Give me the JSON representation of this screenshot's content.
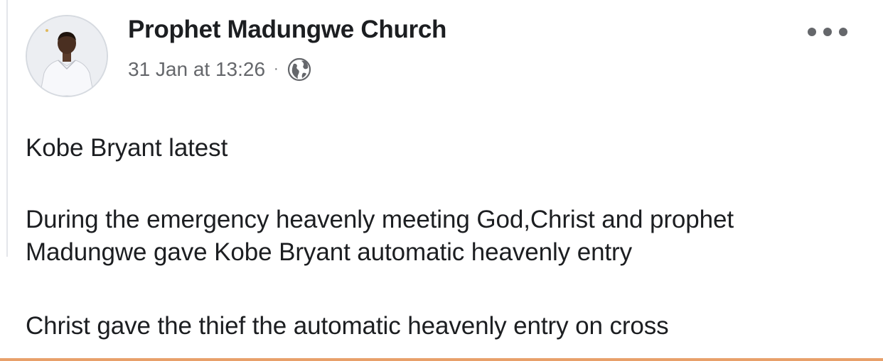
{
  "post": {
    "author": "Prophet Madungwe Church",
    "timestamp": "31 Jan at 13:26",
    "separator": "·",
    "audience_icon": "globe-icon",
    "more_icon": "more-options-icon",
    "paragraphs": [
      "Kobe Bryant latest",
      "During the emergency heavenly meeting God,Christ and prophet",
      "Madungwe gave Kobe Bryant automatic heavenly entry",
      "Christ gave the thief the automatic heavenly entry on cross"
    ]
  },
  "colors": {
    "text_primary": "#1c1e21",
    "text_secondary": "#65676b",
    "accent_bottom_bar": "#e8a06a",
    "background": "#ffffff"
  }
}
